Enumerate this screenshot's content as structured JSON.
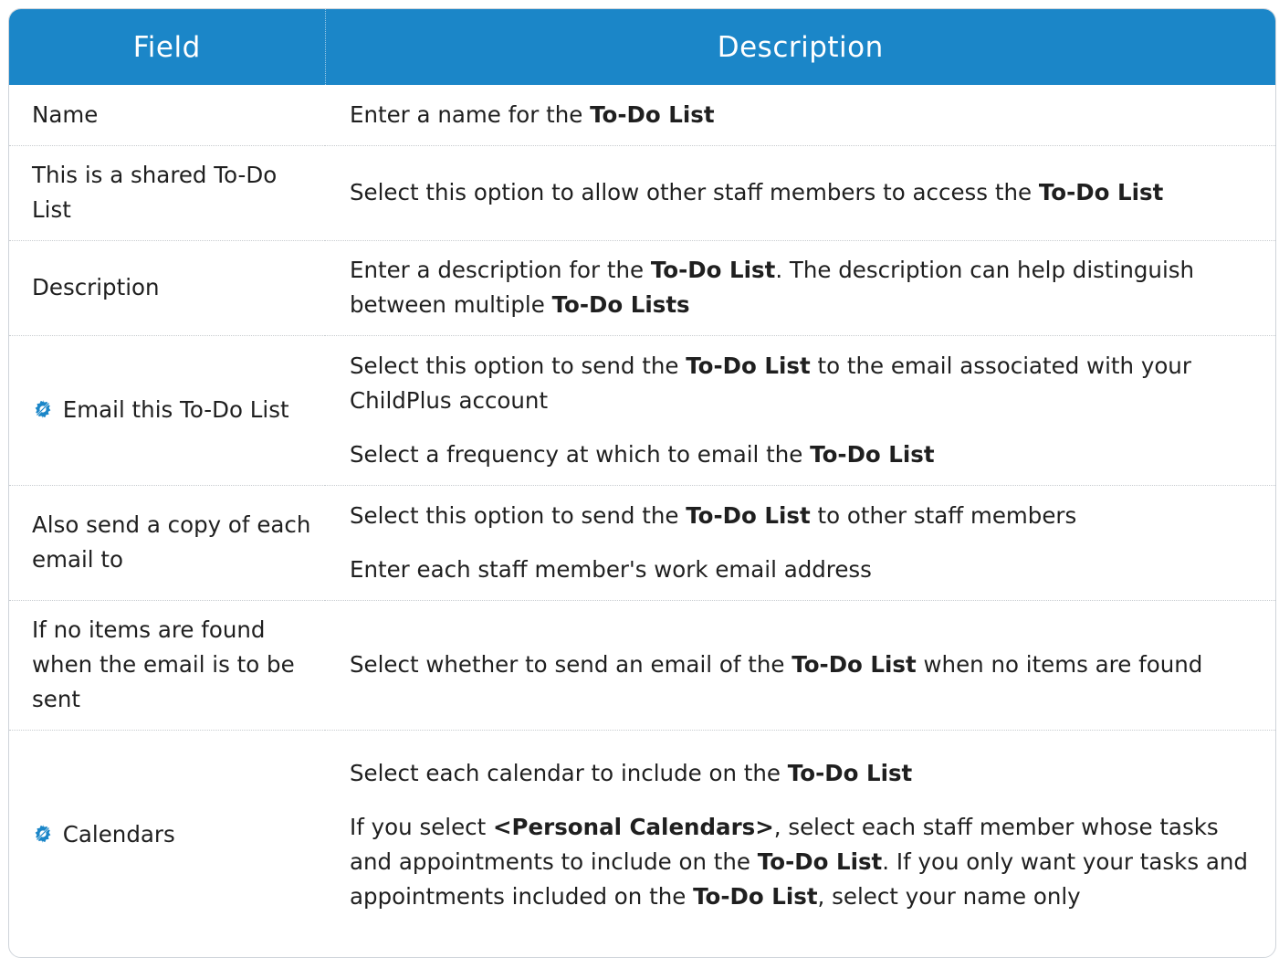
{
  "header": {
    "field": "Field",
    "description": "Description"
  },
  "rows": [
    {
      "field": "Name",
      "desc": [
        [
          "Enter a name for the ",
          {
            "b": "To-Do List"
          }
        ]
      ]
    },
    {
      "field": "This is a shared To-Do List",
      "desc": [
        [
          "Select this option to allow other staff members to access the ",
          {
            "b": "To-Do List"
          }
        ]
      ]
    },
    {
      "field": "Description",
      "desc": [
        [
          "Enter a description for the ",
          {
            "b": "To-Do List"
          },
          ". The description can help distinguish between multiple ",
          {
            "b": "To-Do Lists"
          }
        ]
      ]
    },
    {
      "field": "Email this To-Do List",
      "icon": "gear-icon",
      "desc": [
        [
          "Select this option to send the ",
          {
            "b": "To-Do List"
          },
          " to the email associated with your ChildPlus account"
        ],
        [
          "Select a frequency at which to email the ",
          {
            "b": "To-Do List"
          }
        ]
      ]
    },
    {
      "field": "Also send a copy of each email to",
      "desc": [
        [
          "Select this option to send the ",
          {
            "b": "To-Do List"
          },
          " to other staff members"
        ],
        [
          "Enter each staff member's work email address"
        ]
      ]
    },
    {
      "field": "If no items are found when the email is to be sent",
      "desc": [
        [
          "Select whether to send an email of the ",
          {
            "b": "To-Do List"
          },
          " when no items are found"
        ]
      ]
    },
    {
      "field": "Calendars",
      "icon": "gear-icon",
      "desc": [
        [
          "Select each calendar to include on the ",
          {
            "b": "To-Do List"
          }
        ],
        [
          "If you select ",
          {
            "b": "<Personal Calendars>"
          },
          ", select each staff member whose tasks and appointments to include on the ",
          {
            "b": "To-Do List"
          },
          ". If you only want your tasks and appointments included on the ",
          {
            "b": "To-Do List"
          },
          ", select your name only"
        ]
      ]
    }
  ],
  "colors": {
    "header_bg": "#1b86c8",
    "header_text": "#ffffff",
    "icon_color": "#1b86c8"
  }
}
